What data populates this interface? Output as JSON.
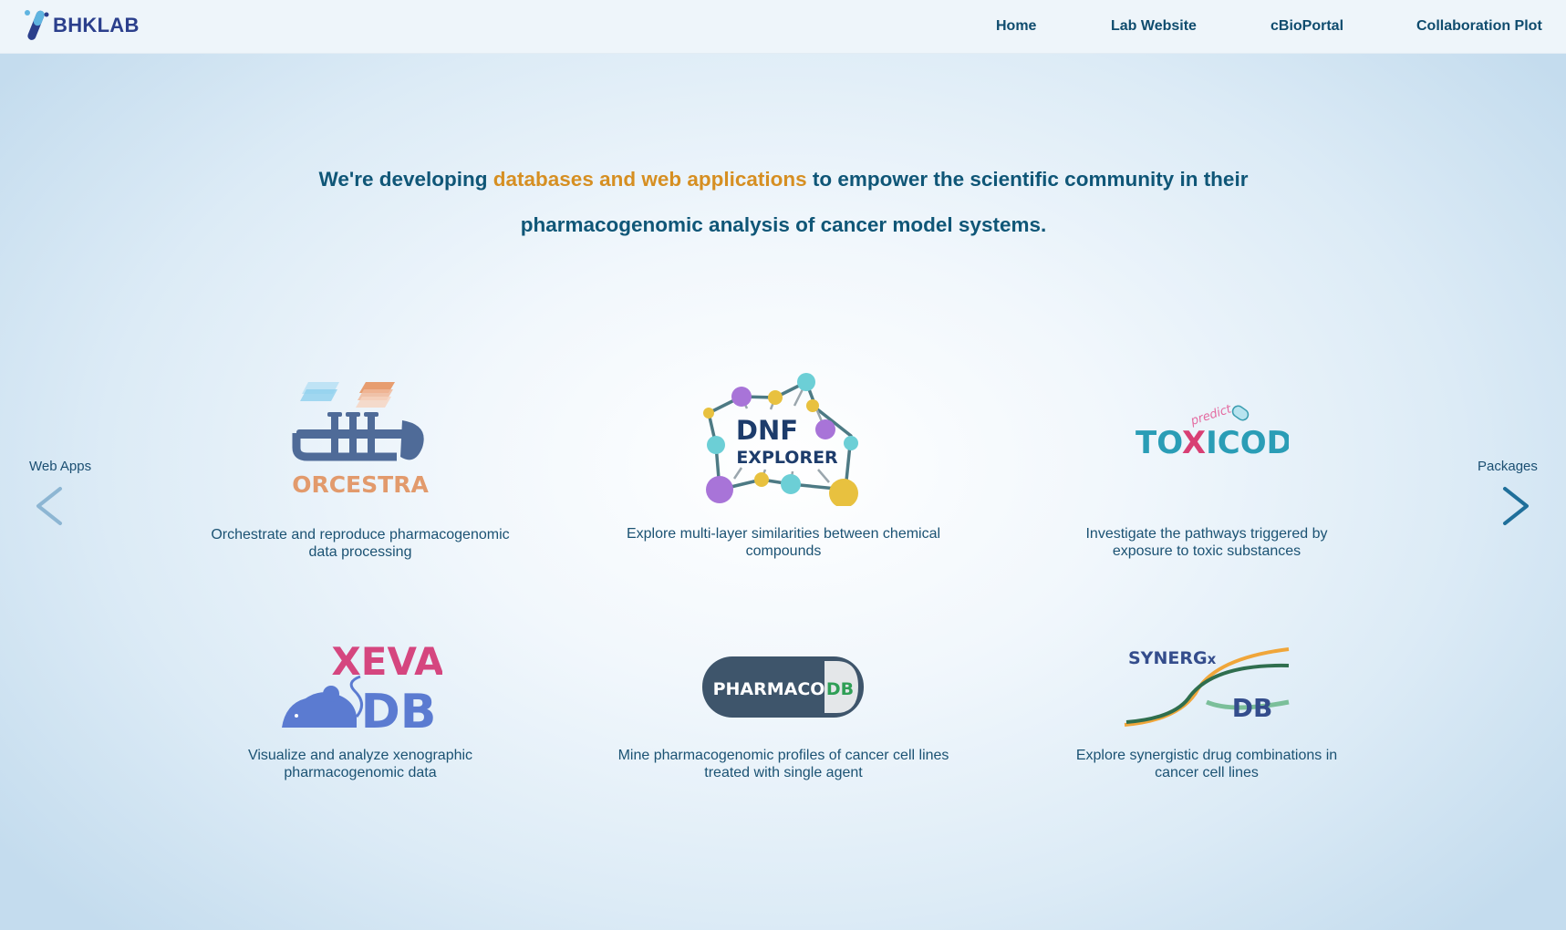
{
  "brand": {
    "name": "BHKLAB"
  },
  "nav": {
    "items": [
      {
        "label": "Home"
      },
      {
        "label": "Lab Website"
      },
      {
        "label": "cBioPortal"
      },
      {
        "label": "Collaboration Plot"
      }
    ]
  },
  "hero": {
    "text_before": "We're developing ",
    "highlight": "databases and web applications",
    "text_after_line1": " to empower the scientific community in their",
    "line2": "pharmacogenomic analysis of cancer model systems."
  },
  "carousel": {
    "prev_label": "Web Apps",
    "next_label": "Packages"
  },
  "apps": [
    {
      "logo_text": "ORCESTRA",
      "description": "Orchestrate and reproduce pharmacogenomic data processing"
    },
    {
      "logo_text": [
        "DNF",
        "EXPLORER"
      ],
      "description": "Explore multi-layer similarities between chemical compounds"
    },
    {
      "logo_text": [
        "TO",
        "X",
        "ICODB"
      ],
      "logo_script": "predict",
      "description": "Investigate the pathways triggered by exposure to toxic substances"
    },
    {
      "logo_text": [
        "XEVA",
        "DB"
      ],
      "description": "Visualize and analyze xenographic pharmacogenomic data"
    },
    {
      "logo_text": [
        "PHARMACO",
        "DB"
      ],
      "description": "Mine pharmacogenomic profiles of cancer cell lines treated with single agent"
    },
    {
      "logo_text": [
        "SYNERG",
        "x",
        "DB"
      ],
      "description": "Explore synergistic drug combinations in cancer cell lines"
    }
  ],
  "colors": {
    "nav_text": "#0f4c6e",
    "hero_text": "#0f5677",
    "hero_highlight": "#d68f22",
    "brand": "#2b3f8c"
  }
}
